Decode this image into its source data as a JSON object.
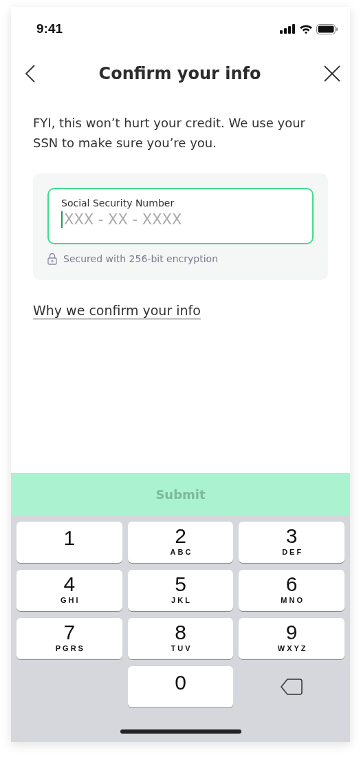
{
  "status_bar": {
    "time": "9:41"
  },
  "nav": {
    "title": "Confirm your info"
  },
  "intro": "FYI, this won’t hurt your credit. We use your SSN to make sure you’re you.",
  "ssn_field": {
    "label": "Social Security Number",
    "placeholder": "XXX - XX - XXXX",
    "focused": true
  },
  "security_note": "Secured with 256-bit encryption",
  "link": "Why we confirm your info",
  "submit": {
    "label": "Submit",
    "disabled": true
  },
  "keypad": [
    {
      "kind": "digit",
      "digit": "1"
    },
    {
      "kind": "digit",
      "digit": "2",
      "letters": "ABC"
    },
    {
      "kind": "digit",
      "digit": "3",
      "letters": "DEF"
    },
    {
      "kind": "digit",
      "digit": "4",
      "letters": "GHI"
    },
    {
      "kind": "digit",
      "digit": "5",
      "letters": "JKL"
    },
    {
      "kind": "digit",
      "digit": "6",
      "letters": "MNO"
    },
    {
      "kind": "digit",
      "digit": "7",
      "letters": "PGRS"
    },
    {
      "kind": "digit",
      "digit": "8",
      "letters": "TUV"
    },
    {
      "kind": "digit",
      "digit": "9",
      "letters": "WXYZ"
    },
    {
      "kind": "blank"
    },
    {
      "kind": "digit",
      "digit": "0"
    },
    {
      "kind": "delete"
    }
  ]
}
